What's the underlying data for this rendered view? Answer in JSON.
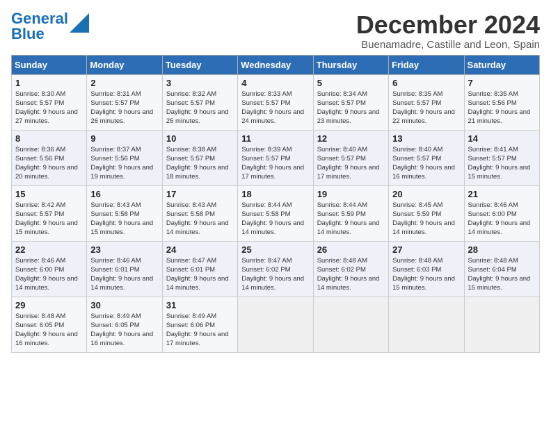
{
  "logo": {
    "line1": "General",
    "line2": "Blue"
  },
  "calendar": {
    "title": "December 2024",
    "subtitle": "Buenamadre, Castille and Leon, Spain"
  },
  "headers": [
    "Sunday",
    "Monday",
    "Tuesday",
    "Wednesday",
    "Thursday",
    "Friday",
    "Saturday"
  ],
  "weeks": [
    [
      {
        "day": "1",
        "sunrise": "Sunrise: 8:30 AM",
        "sunset": "Sunset: 5:57 PM",
        "daylight": "Daylight: 9 hours and 27 minutes."
      },
      {
        "day": "2",
        "sunrise": "Sunrise: 8:31 AM",
        "sunset": "Sunset: 5:57 PM",
        "daylight": "Daylight: 9 hours and 26 minutes."
      },
      {
        "day": "3",
        "sunrise": "Sunrise: 8:32 AM",
        "sunset": "Sunset: 5:57 PM",
        "daylight": "Daylight: 9 hours and 25 minutes."
      },
      {
        "day": "4",
        "sunrise": "Sunrise: 8:33 AM",
        "sunset": "Sunset: 5:57 PM",
        "daylight": "Daylight: 9 hours and 24 minutes."
      },
      {
        "day": "5",
        "sunrise": "Sunrise: 8:34 AM",
        "sunset": "Sunset: 5:57 PM",
        "daylight": "Daylight: 9 hours and 23 minutes."
      },
      {
        "day": "6",
        "sunrise": "Sunrise: 8:35 AM",
        "sunset": "Sunset: 5:57 PM",
        "daylight": "Daylight: 9 hours and 22 minutes."
      },
      {
        "day": "7",
        "sunrise": "Sunrise: 8:35 AM",
        "sunset": "Sunset: 5:56 PM",
        "daylight": "Daylight: 9 hours and 21 minutes."
      }
    ],
    [
      {
        "day": "8",
        "sunrise": "Sunrise: 8:36 AM",
        "sunset": "Sunset: 5:56 PM",
        "daylight": "Daylight: 9 hours and 20 minutes."
      },
      {
        "day": "9",
        "sunrise": "Sunrise: 8:37 AM",
        "sunset": "Sunset: 5:56 PM",
        "daylight": "Daylight: 9 hours and 19 minutes."
      },
      {
        "day": "10",
        "sunrise": "Sunrise: 8:38 AM",
        "sunset": "Sunset: 5:57 PM",
        "daylight": "Daylight: 9 hours and 18 minutes."
      },
      {
        "day": "11",
        "sunrise": "Sunrise: 8:39 AM",
        "sunset": "Sunset: 5:57 PM",
        "daylight": "Daylight: 9 hours and 17 minutes."
      },
      {
        "day": "12",
        "sunrise": "Sunrise: 8:40 AM",
        "sunset": "Sunset: 5:57 PM",
        "daylight": "Daylight: 9 hours and 17 minutes."
      },
      {
        "day": "13",
        "sunrise": "Sunrise: 8:40 AM",
        "sunset": "Sunset: 5:57 PM",
        "daylight": "Daylight: 9 hours and 16 minutes."
      },
      {
        "day": "14",
        "sunrise": "Sunrise: 8:41 AM",
        "sunset": "Sunset: 5:57 PM",
        "daylight": "Daylight: 9 hours and 15 minutes."
      }
    ],
    [
      {
        "day": "15",
        "sunrise": "Sunrise: 8:42 AM",
        "sunset": "Sunset: 5:57 PM",
        "daylight": "Daylight: 9 hours and 15 minutes."
      },
      {
        "day": "16",
        "sunrise": "Sunrise: 8:43 AM",
        "sunset": "Sunset: 5:58 PM",
        "daylight": "Daylight: 9 hours and 15 minutes."
      },
      {
        "day": "17",
        "sunrise": "Sunrise: 8:43 AM",
        "sunset": "Sunset: 5:58 PM",
        "daylight": "Daylight: 9 hours and 14 minutes."
      },
      {
        "day": "18",
        "sunrise": "Sunrise: 8:44 AM",
        "sunset": "Sunset: 5:58 PM",
        "daylight": "Daylight: 9 hours and 14 minutes."
      },
      {
        "day": "19",
        "sunrise": "Sunrise: 8:44 AM",
        "sunset": "Sunset: 5:59 PM",
        "daylight": "Daylight: 9 hours and 14 minutes."
      },
      {
        "day": "20",
        "sunrise": "Sunrise: 8:45 AM",
        "sunset": "Sunset: 5:59 PM",
        "daylight": "Daylight: 9 hours and 14 minutes."
      },
      {
        "day": "21",
        "sunrise": "Sunrise: 8:46 AM",
        "sunset": "Sunset: 6:00 PM",
        "daylight": "Daylight: 9 hours and 14 minutes."
      }
    ],
    [
      {
        "day": "22",
        "sunrise": "Sunrise: 8:46 AM",
        "sunset": "Sunset: 6:00 PM",
        "daylight": "Daylight: 9 hours and 14 minutes."
      },
      {
        "day": "23",
        "sunrise": "Sunrise: 8:46 AM",
        "sunset": "Sunset: 6:01 PM",
        "daylight": "Daylight: 9 hours and 14 minutes."
      },
      {
        "day": "24",
        "sunrise": "Sunrise: 8:47 AM",
        "sunset": "Sunset: 6:01 PM",
        "daylight": "Daylight: 9 hours and 14 minutes."
      },
      {
        "day": "25",
        "sunrise": "Sunrise: 8:47 AM",
        "sunset": "Sunset: 6:02 PM",
        "daylight": "Daylight: 9 hours and 14 minutes."
      },
      {
        "day": "26",
        "sunrise": "Sunrise: 8:48 AM",
        "sunset": "Sunset: 6:02 PM",
        "daylight": "Daylight: 9 hours and 14 minutes."
      },
      {
        "day": "27",
        "sunrise": "Sunrise: 8:48 AM",
        "sunset": "Sunset: 6:03 PM",
        "daylight": "Daylight: 9 hours and 15 minutes."
      },
      {
        "day": "28",
        "sunrise": "Sunrise: 8:48 AM",
        "sunset": "Sunset: 6:04 PM",
        "daylight": "Daylight: 9 hours and 15 minutes."
      }
    ],
    [
      {
        "day": "29",
        "sunrise": "Sunrise: 8:48 AM",
        "sunset": "Sunset: 6:05 PM",
        "daylight": "Daylight: 9 hours and 16 minutes."
      },
      {
        "day": "30",
        "sunrise": "Sunrise: 8:49 AM",
        "sunset": "Sunset: 6:05 PM",
        "daylight": "Daylight: 9 hours and 16 minutes."
      },
      {
        "day": "31",
        "sunrise": "Sunrise: 8:49 AM",
        "sunset": "Sunset: 6:06 PM",
        "daylight": "Daylight: 9 hours and 17 minutes."
      },
      null,
      null,
      null,
      null
    ]
  ]
}
